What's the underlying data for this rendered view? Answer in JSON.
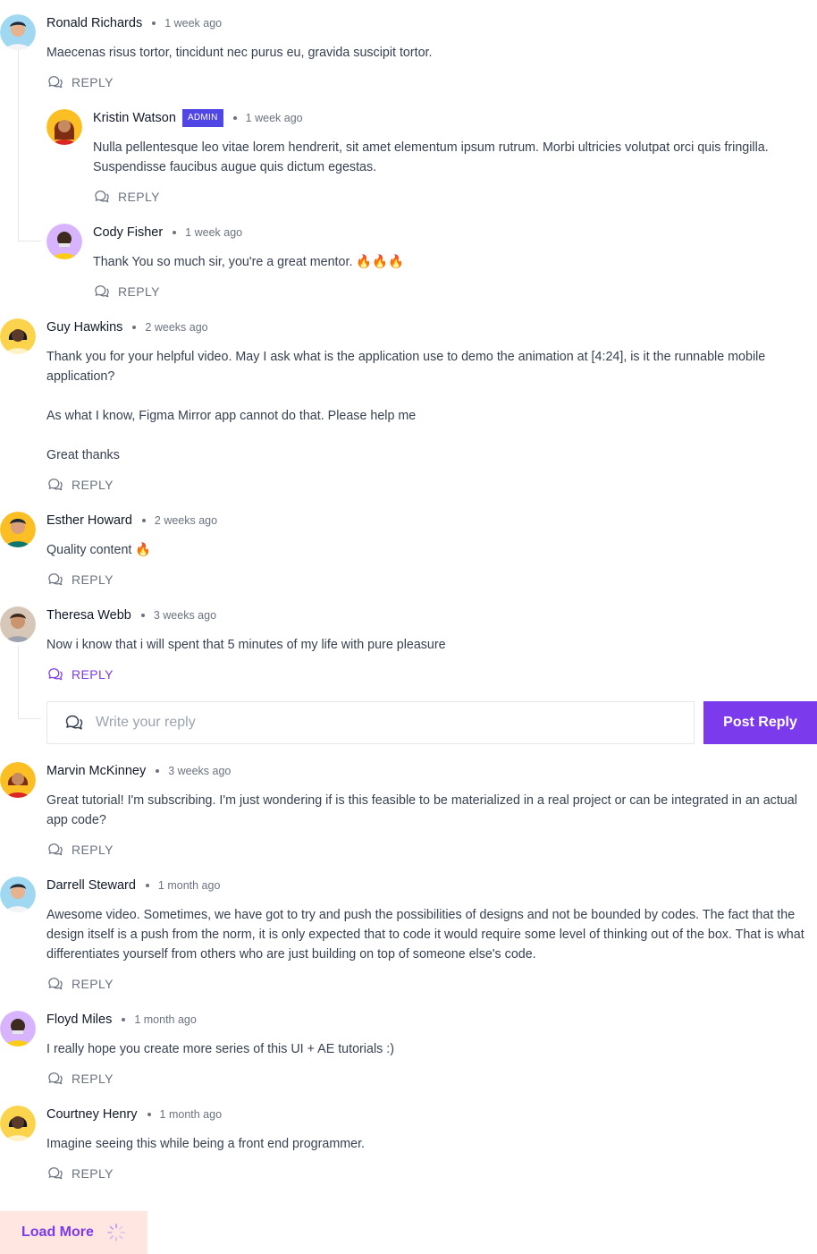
{
  "reply_label": "REPLY",
  "comments": [
    {
      "author": "Ronald Richards",
      "time": "1 week ago",
      "text": "Maecenas risus tortor, tincidunt nec purus eu, gravida suscipit tortor."
    },
    {
      "author": "Kristin Watson",
      "badge": "ADMIN",
      "time": "1 week ago",
      "text": "Nulla pellentesque leo vitae lorem hendrerit, sit amet elementum ipsum rutrum. Morbi ultricies volutpat orci quis fringilla. Suspendisse faucibus augue quis dictum egestas."
    },
    {
      "author": "Cody Fisher",
      "time": "1 week ago",
      "text": "Thank You so much sir, you're a great mentor. 🔥🔥🔥"
    },
    {
      "author": "Guy Hawkins",
      "time": "2 weeks ago",
      "paragraphs": [
        "Thank you for your helpful video. May I ask what is the application use to demo the animation at [4:24], is it the runnable mobile application?",
        "As what I know, Figma Mirror app cannot do that. Please help me",
        "Great thanks"
      ]
    },
    {
      "author": "Esther Howard",
      "time": "2 weeks ago",
      "text": "Quality content 🔥"
    },
    {
      "author": "Theresa Webb",
      "time": "3 weeks ago",
      "text": "Now i know that i will spent that 5 minutes of my life with pure pleasure"
    },
    {
      "author": "Marvin McKinney",
      "time": "3 weeks ago",
      "text": "Great tutorial! I'm subscribing. I'm just wondering if is this feasible to be materialized in a real project or can be integrated in an actual app code?"
    },
    {
      "author": "Darrell Steward",
      "time": "1 month ago",
      "text": "Awesome video. Sometimes, we have got to try and push the possibilities of designs and not be bounded by codes. The fact that the design itself is a push from the norm, it is only expected that to code it would require some level of thinking out of the box. That is what differentiates yourself from others who are just building on top of someone else's code."
    },
    {
      "author": "Floyd Miles",
      "time": "1 month ago",
      "text": "I really hope you create more series of this UI + AE tutorials :)"
    },
    {
      "author": "Courtney Henry",
      "time": "1 month ago",
      "text": "Imagine seeing this while being a front end programmer."
    }
  ],
  "reply_input": {
    "placeholder": "Write your reply",
    "value": ""
  },
  "post_reply_label": "Post Reply",
  "load_more_label": "Load More",
  "colors": {
    "accent": "#7c3aed",
    "admin_badge": "#4f46e5",
    "load_more_bg": "#ffe6e1"
  },
  "icons": {
    "reply": "chat-bubbles-icon",
    "loading": "spinner-icon"
  }
}
